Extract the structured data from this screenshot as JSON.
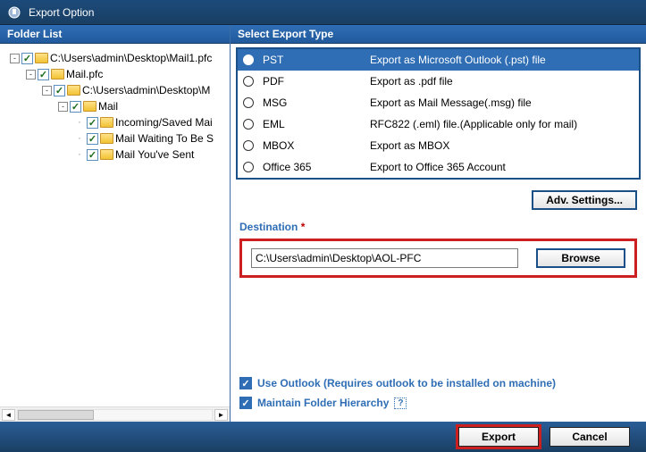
{
  "window": {
    "title": "Export Option"
  },
  "left": {
    "header": "Folder List",
    "tree": [
      {
        "depth": 0,
        "expander": "-",
        "checked": true,
        "label": "C:\\Users\\admin\\Desktop\\Mail1.pfc"
      },
      {
        "depth": 1,
        "expander": "-",
        "checked": true,
        "label": "Mail.pfc"
      },
      {
        "depth": 2,
        "expander": "-",
        "checked": true,
        "label": "C:\\Users\\admin\\Desktop\\M"
      },
      {
        "depth": 3,
        "expander": "-",
        "checked": true,
        "label": "Mail"
      },
      {
        "depth": 4,
        "expander": "",
        "checked": true,
        "label": "Incoming/Saved Mai"
      },
      {
        "depth": 4,
        "expander": "",
        "checked": true,
        "label": "Mail Waiting To Be S"
      },
      {
        "depth": 4,
        "expander": "",
        "checked": true,
        "label": "Mail You've Sent"
      }
    ]
  },
  "right": {
    "header": "Select Export Type",
    "types": [
      {
        "name": "PST",
        "desc": "Export as Microsoft Outlook (.pst) file",
        "selected": true
      },
      {
        "name": "PDF",
        "desc": "Export as .pdf file",
        "selected": false
      },
      {
        "name": "MSG",
        "desc": "Export as Mail Message(.msg) file",
        "selected": false
      },
      {
        "name": "EML",
        "desc": "RFC822 (.eml) file.(Applicable only for mail)",
        "selected": false
      },
      {
        "name": "MBOX",
        "desc": "Export as MBOX",
        "selected": false
      },
      {
        "name": "Office 365",
        "desc": "Export to Office 365 Account",
        "selected": false
      }
    ],
    "adv_label": "Adv. Settings...",
    "dest_label": "Destination",
    "dest_value": "C:\\Users\\admin\\Desktop\\AOL-PFC",
    "browse_label": "Browse",
    "opt_use_outlook": "Use Outlook (Requires outlook to be installed on machine)",
    "opt_maintain": "Maintain Folder Hierarchy",
    "help_symbol": "?"
  },
  "footer": {
    "export": "Export",
    "cancel": "Cancel"
  }
}
